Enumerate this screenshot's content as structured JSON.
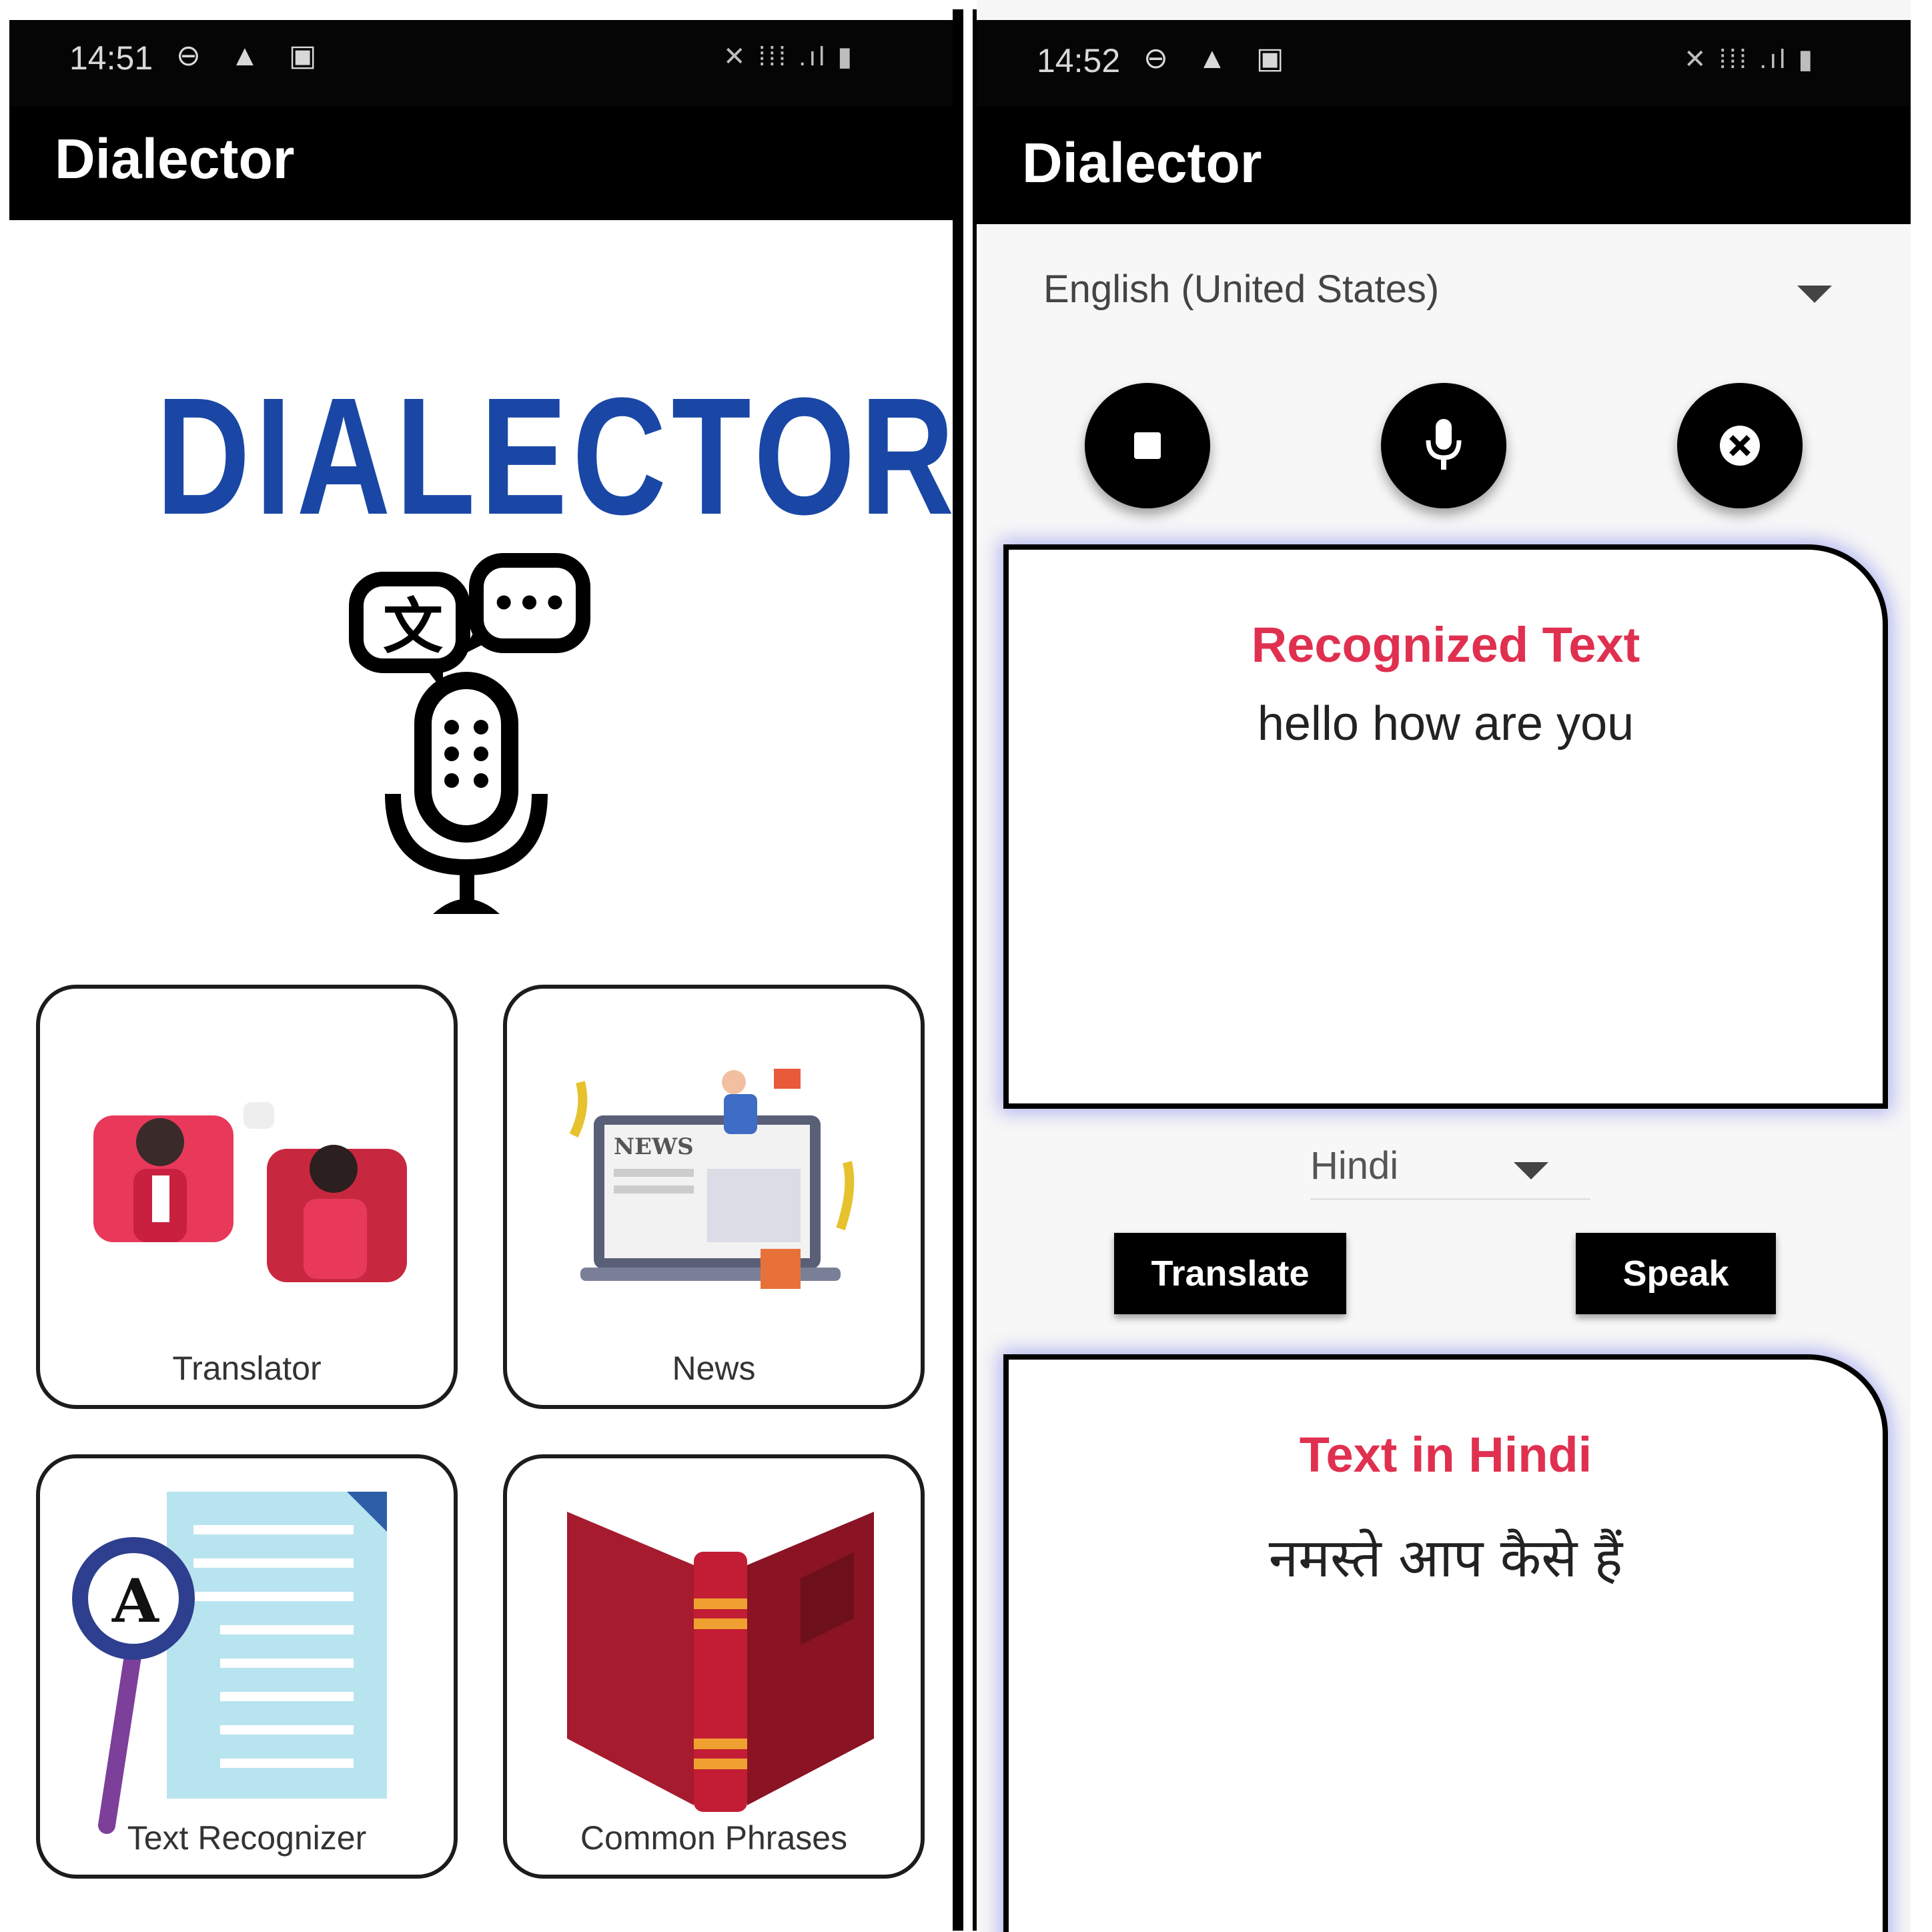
{
  "left_screen": {
    "status_time": "14:51",
    "status_icons_left": "⊖ ▲ ▣",
    "status_icons_right": "✕ ⁞⁞⁞ .ıl ▮",
    "app_title": "Dialector",
    "logo_text": "DIALECTOR",
    "cards": [
      {
        "label": "Translator",
        "icon": "translator-illustration"
      },
      {
        "label": "News",
        "icon": "news-illustration"
      },
      {
        "label": "Text Recognizer",
        "icon": "text-recognizer-illustration"
      },
      {
        "label": "Common Phrases",
        "icon": "book-illustration"
      }
    ],
    "logo_bubble_text": "•••",
    "logo_glyph": "文"
  },
  "right_screen": {
    "status_time": "14:52",
    "status_icons_left": "⊖ ▲ ▣",
    "status_icons_right": "✕ ⁞⁞⁞ .ıl ▮",
    "app_title": "Dialector",
    "source_language": "English (United States)",
    "controls": [
      "stop-icon",
      "mic-icon",
      "clear-icon"
    ],
    "recognized_title": "Recognized Text",
    "recognized_text": "hello how are you",
    "target_language": "Hindi",
    "translate_label": "Translate",
    "speak_label": "Speak",
    "translated_title": "Text in Hindi",
    "translated_text": "नमस्ते आप कैसे हैं"
  },
  "colors": {
    "logo_blue": "#1a47a5",
    "panel_title_red": "#e03050",
    "panel_glow": "#5a64e6",
    "appbar": "#000000"
  }
}
